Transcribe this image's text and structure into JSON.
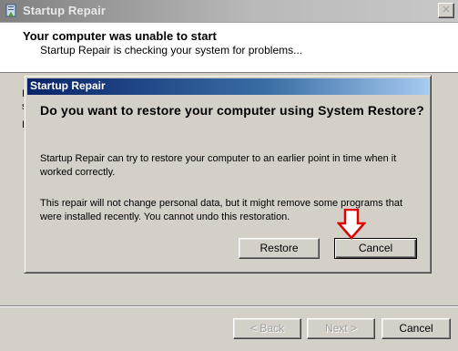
{
  "window": {
    "title": "Startup Repair",
    "heading": "Your computer was unable to start",
    "subheading": "Startup Repair is checking your system for problems...",
    "bg_fragments": [
      "I",
      "s",
      "I"
    ]
  },
  "dialog": {
    "title": "Startup Repair",
    "question": "Do you want to restore your computer using System Restore?",
    "paragraph1": "Startup Repair can try to restore your computer to an earlier point in time when it worked correctly.",
    "paragraph2": "This repair will not change personal data, but it might remove some programs that were installed recently. You cannot undo this restoration.",
    "restore_label": "Restore",
    "cancel_label": "Cancel"
  },
  "footer": {
    "back_label": "< Back",
    "next_label": "Next >",
    "cancel_label": "Cancel"
  },
  "annotation": {
    "arrow_color": "#e00000"
  }
}
